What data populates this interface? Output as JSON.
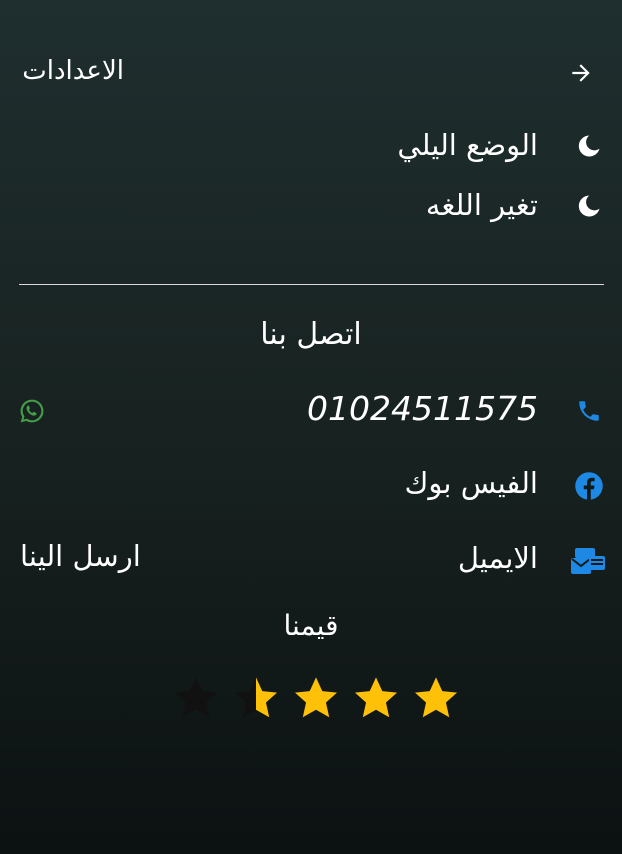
{
  "header": {
    "title": "الاعدادات",
    "back_icon": "arrow-right-icon"
  },
  "settings": [
    {
      "label": "الوضع اليلي",
      "icon": "moon-icon"
    },
    {
      "label": "تغير اللغه",
      "icon": "moon-icon"
    }
  ],
  "contact": {
    "title": "اتصل بنا",
    "phone": "01024511575",
    "facebook": "الفيس بوك",
    "email": "الايميل",
    "send": "ارسل الينا"
  },
  "rating": {
    "title": "قيمنا",
    "value": 3.5,
    "max": 5
  },
  "colors": {
    "accent_blue": "#1e88e5",
    "whatsapp": "#43a047",
    "star_gold": "#ffc107",
    "star_empty": "#111111"
  }
}
